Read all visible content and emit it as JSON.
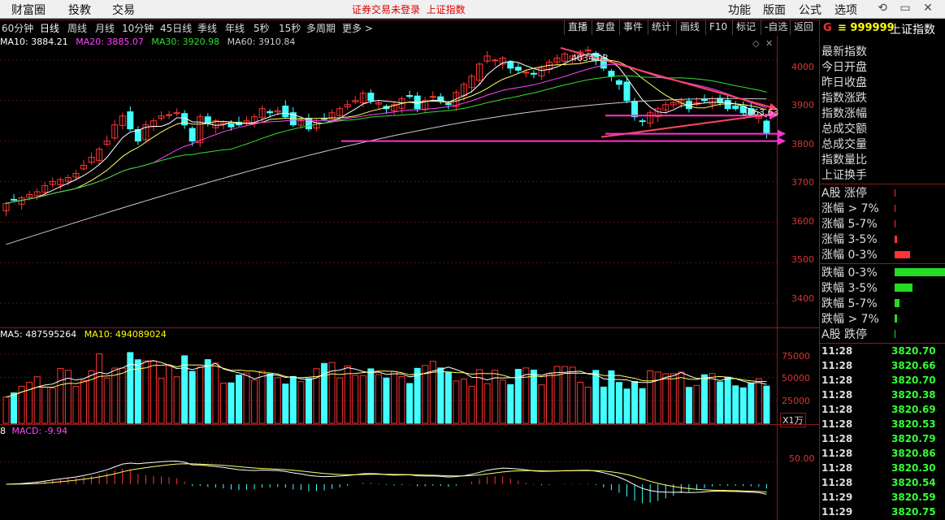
{
  "topbar": {
    "menu": [
      "财富圈",
      "投教",
      "交易"
    ],
    "notice": "证券交易未登录",
    "notice_name": "上证指数",
    "right_menu": [
      "功能",
      "版面",
      "公式",
      "选项"
    ]
  },
  "periods": [
    "60分钟",
    "日线",
    "周线",
    "月线",
    "10分钟",
    "45日线",
    "季线",
    "年线",
    "5秒",
    "15秒",
    "多周期",
    "更多 >"
  ],
  "active_period": "日线",
  "tools": [
    "直播",
    "复盘",
    "事件",
    "统计",
    "画线",
    "F10",
    "标记",
    "-自选",
    "返回"
  ],
  "ma_legend": {
    "ma10": "MA10: 3884.21",
    "ma20": "MA20: 3885.07",
    "ma30": "MA30: 3920.98",
    "ma60": "MA60: 3910.84",
    "colors": {
      "ma10": "#ffffff",
      "ma20": "#ff44ff",
      "ma30": "#33dd33",
      "ma60": "#cccccc"
    }
  },
  "price_axis": [
    "4000",
    "3900",
    "3800",
    "3700",
    "3600",
    "3500",
    "3400"
  ],
  "high_label": "4034.08",
  "last_label": "3863.63",
  "volume_legend": {
    "ma5": "MA5: 487595264",
    "ma10": "MA10: 494089024"
  },
  "volume_axis": [
    "75000",
    "50000",
    "25000"
  ],
  "volume_unit": "X1万",
  "macd_legend": {
    "prefix": "8",
    "text": "MACD: -9.94"
  },
  "macd_axis": [
    "50.00"
  ],
  "security": {
    "flag": "G",
    "code": "999999",
    "name": "上证指数"
  },
  "stat_labels": [
    "最新指数",
    "今日开盘",
    "昨日收盘",
    "指数涨跌",
    "指数涨幅",
    "总成交额",
    "总成交量",
    "指数量比",
    "上证换手"
  ],
  "breadth_up": [
    {
      "label": "A股 涨停",
      "bar": 0.01
    },
    {
      "label": "涨幅 > 7%",
      "bar": 0.01
    },
    {
      "label": "涨幅 5-7%",
      "bar": 0.01
    },
    {
      "label": "涨幅 3-5%",
      "bar": 0.05
    },
    {
      "label": "涨幅 0-3%",
      "bar": 0.3
    }
  ],
  "breadth_down": [
    {
      "label": "跌幅 0-3%",
      "bar": 1.0
    },
    {
      "label": "跌幅 3-5%",
      "bar": 0.35
    },
    {
      "label": "跌幅 5-7%",
      "bar": 0.1
    },
    {
      "label": "跌幅 > 7%",
      "bar": 0.05
    },
    {
      "label": "A股 跌停",
      "bar": 0.01
    }
  ],
  "ticks": [
    {
      "time": "11:28",
      "price": "3820.70"
    },
    {
      "time": "11:28",
      "price": "3820.66"
    },
    {
      "time": "11:28",
      "price": "3820.70"
    },
    {
      "time": "11:28",
      "price": "3820.38"
    },
    {
      "time": "11:28",
      "price": "3820.69"
    },
    {
      "time": "11:28",
      "price": "3820.53"
    },
    {
      "time": "11:28",
      "price": "3820.79"
    },
    {
      "time": "11:28",
      "price": "3820.86"
    },
    {
      "time": "11:28",
      "price": "3820.30"
    },
    {
      "time": "11:28",
      "price": "3820.54"
    },
    {
      "time": "11:29",
      "price": "3820.59"
    },
    {
      "time": "11:29",
      "price": "3820.75"
    }
  ],
  "chart_data": {
    "type": "line",
    "title": "上证指数",
    "xlabel": "",
    "ylabel": "",
    "ylim": [
      3340,
      4060
    ],
    "ma_series": [
      {
        "name": "MA10",
        "last": 3884.21
      },
      {
        "name": "MA20",
        "last": 3885.07
      },
      {
        "name": "MA30",
        "last": 3920.98
      },
      {
        "name": "MA60",
        "last": 3910.84
      }
    ],
    "candles_close": [
      3646,
      3655,
      3660,
      3668,
      3675,
      3690,
      3700,
      3705,
      3710,
      3720,
      3740,
      3760,
      3780,
      3800,
      3840,
      3862,
      3830,
      3800,
      3840,
      3850,
      3862,
      3865,
      3870,
      3840,
      3800,
      3860,
      3845,
      3850,
      3845,
      3835,
      3840,
      3850,
      3860,
      3880,
      3870,
      3875,
      3860,
      3840,
      3850,
      3830,
      3845,
      3855,
      3870,
      3880,
      3890,
      3900,
      3918,
      3900,
      3895,
      3880,
      3890,
      3905,
      3910,
      3880,
      3900,
      3910,
      3900,
      3890,
      3920,
      3940,
      3960,
      3990,
      4010,
      4000,
      4005,
      3980,
      3975,
      3970,
      3965,
      3980,
      3995,
      4005,
      4015,
      4010,
      4020,
      4025,
      4000,
      3980,
      3960,
      3940,
      3900,
      3860,
      3850,
      3870,
      3880,
      3890,
      3895,
      3900,
      3880,
      3895,
      3900,
      3905,
      3895,
      3880,
      3880,
      3870,
      3865,
      3860,
      3820
    ],
    "volume_axis_ticks": [
      25000,
      50000,
      75000
    ],
    "macd_axis_ticks": [
      50.0
    ]
  }
}
